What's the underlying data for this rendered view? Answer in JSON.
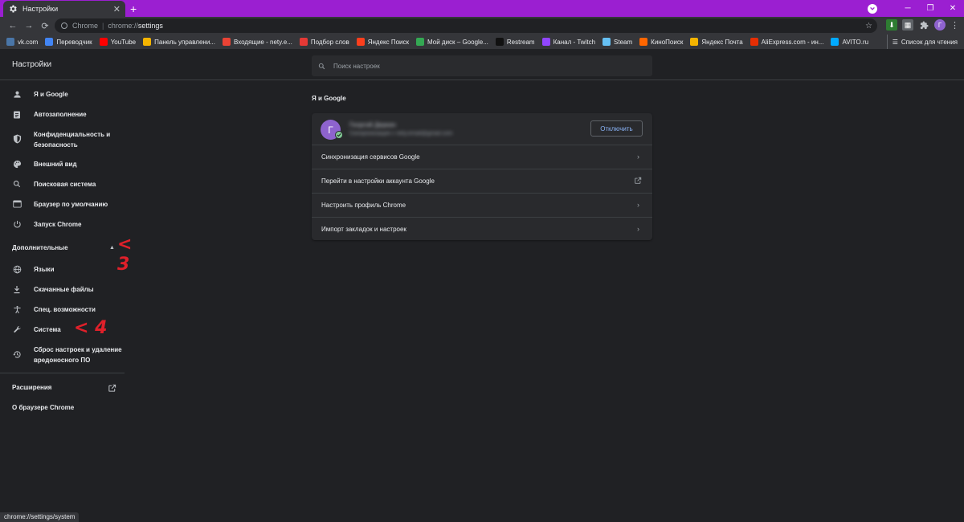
{
  "tab": {
    "title": "Настройки",
    "close": "✕",
    "new_tab": "+"
  },
  "window": {
    "minimize": "─",
    "maximize": "❐",
    "close": "✕"
  },
  "toolbar": {
    "back": "←",
    "forward": "→",
    "reload": "⟳",
    "omnibox_label": "Chrome",
    "omnibox_sep": "|",
    "omnibox_scheme": "chrome://",
    "omnibox_path": "settings",
    "star": "☆",
    "avatar_letter": "Г",
    "menu": "⋮"
  },
  "bookmarks": {
    "items": [
      {
        "label": "vk.com",
        "color": "#4a76a8"
      },
      {
        "label": "Переводчик",
        "color": "#4285f4"
      },
      {
        "label": "YouTube",
        "color": "#ff0000"
      },
      {
        "label": "Панель управлени...",
        "color": "#f4b400"
      },
      {
        "label": "Входящие - nety.e...",
        "color": "#ea4335"
      },
      {
        "label": "Подбор слов",
        "color": "#e53935"
      },
      {
        "label": "Яндекс Поиск",
        "color": "#fc3f1d"
      },
      {
        "label": "Мой диск – Google...",
        "color": "#34a853"
      },
      {
        "label": "Restream",
        "color": "#111111"
      },
      {
        "label": "Канал - Twitch",
        "color": "#9146ff"
      },
      {
        "label": "Steam",
        "color": "#66c0f4"
      },
      {
        "label": "КиноПоиск",
        "color": "#ff6600"
      },
      {
        "label": "Яндекс Почта",
        "color": "#f4b400"
      },
      {
        "label": "AliExpress.com - ин...",
        "color": "#e62e04"
      },
      {
        "label": "AVITO.ru",
        "color": "#00aaff"
      }
    ],
    "reading_list": "Список для чтения"
  },
  "settings": {
    "title": "Настройки",
    "search_placeholder": "Поиск настроек"
  },
  "sidebar": {
    "items": [
      {
        "label": "Я и Google",
        "icon": "person-icon"
      },
      {
        "label": "Автозаполнение",
        "icon": "clipboard-icon"
      },
      {
        "label": "Конфиденциальность и",
        "label2": "безопасность",
        "icon": "shield-icon"
      },
      {
        "label": "Внешний вид",
        "icon": "palette-icon"
      },
      {
        "label": "Поисковая система",
        "icon": "search-icon"
      },
      {
        "label": "Браузер по умолчанию",
        "icon": "browser-icon"
      },
      {
        "label": "Запуск Chrome",
        "icon": "power-icon"
      }
    ],
    "advanced": "Дополнительные",
    "advanced_items": [
      {
        "label": "Языки",
        "icon": "globe-icon"
      },
      {
        "label": "Скачанные файлы",
        "icon": "download-icon"
      },
      {
        "label": "Спец. возможности",
        "icon": "accessibility-icon"
      },
      {
        "label": "Система",
        "icon": "wrench-icon"
      },
      {
        "label": "Сброс настроек и удаление",
        "label2": "вредоносного ПО",
        "icon": "restore-icon"
      }
    ],
    "extensions": "Расширения",
    "about": "О браузере Chrome",
    "annot_3": "< 3",
    "annot_4": "< 4"
  },
  "main": {
    "section_title": "Я и Google",
    "profile": {
      "avatar_letter": "Г",
      "name": "Георгий Деркач",
      "email": "Синхронизация с nety.email@gmail.com"
    },
    "signout_label": "Отключить",
    "rows": [
      {
        "label": "Синхронизация сервисов Google",
        "trail": "›"
      },
      {
        "label": "Перейти в настройки аккаунта Google",
        "trail": "external"
      },
      {
        "label": "Настроить профиль Chrome",
        "trail": "›"
      },
      {
        "label": "Импорт закладок и настроек",
        "trail": "›"
      }
    ]
  },
  "status_url": "chrome://settings/system"
}
